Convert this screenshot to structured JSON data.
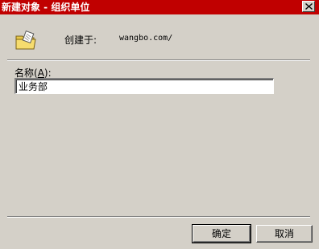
{
  "window": {
    "title": "新建对象 - 组织单位"
  },
  "icons": {
    "close": "close-icon",
    "folder": "folder-icon"
  },
  "info": {
    "created_label": "创建于:",
    "created_path": "wangbo.com/"
  },
  "form": {
    "name_label_prefix": "名称(",
    "name_label_accel": "A",
    "name_label_suffix": "):",
    "name_value": "业务部"
  },
  "buttons": {
    "ok_label": "确定",
    "cancel_label": "取消"
  },
  "colors": {
    "titlebar": "#c00000",
    "dialog_background": "#d4d0c8"
  }
}
